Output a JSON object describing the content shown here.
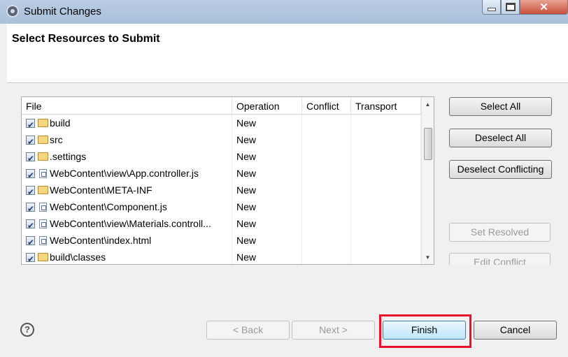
{
  "window": {
    "title": "Submit Changes",
    "close_glyph": "✕"
  },
  "header": {
    "heading": "Select Resources to Submit"
  },
  "table": {
    "columns": [
      "File",
      "Operation",
      "Conflict",
      "Transport"
    ],
    "rows": [
      {
        "file": "build",
        "icon": "folder-icon",
        "operation": "New",
        "conflict": "",
        "transport": "",
        "checked": true
      },
      {
        "file": "src",
        "icon": "folder-icon",
        "operation": "New",
        "conflict": "",
        "transport": "",
        "checked": true
      },
      {
        "file": ".settings",
        "icon": "folder-icon",
        "operation": "New",
        "conflict": "",
        "transport": "",
        "checked": true
      },
      {
        "file": "WebContent\\view\\App.controller.js",
        "icon": "file-icon",
        "operation": "New",
        "conflict": "",
        "transport": "",
        "checked": true
      },
      {
        "file": "WebContent\\META-INF",
        "icon": "folder-icon",
        "operation": "New",
        "conflict": "",
        "transport": "",
        "checked": true
      },
      {
        "file": "WebContent\\Component.js",
        "icon": "file-icon",
        "operation": "New",
        "conflict": "",
        "transport": "",
        "checked": true
      },
      {
        "file": "WebContent\\view\\Materials.controll...",
        "icon": "file-icon",
        "operation": "New",
        "conflict": "",
        "transport": "",
        "checked": true
      },
      {
        "file": "WebContent\\index.html",
        "icon": "file-icon",
        "operation": "New",
        "conflict": "",
        "transport": "",
        "checked": true
      },
      {
        "file": "build\\classes",
        "icon": "folder-icon",
        "operation": "New",
        "conflict": "",
        "transport": "",
        "checked": true
      }
    ]
  },
  "side_buttons": {
    "select_all": "Select All",
    "deselect_all": "Deselect All",
    "deselect_conflicting": "Deselect Conflicting",
    "set_resolved": "Set Resolved",
    "edit_conflict": "Edit Conflict"
  },
  "footer": {
    "help": "?",
    "back": "< Back",
    "next": "Next >",
    "finish": "Finish",
    "cancel": "Cancel"
  },
  "colors": {
    "highlight": "#e8102a",
    "titlebar": "#b9cde3"
  }
}
